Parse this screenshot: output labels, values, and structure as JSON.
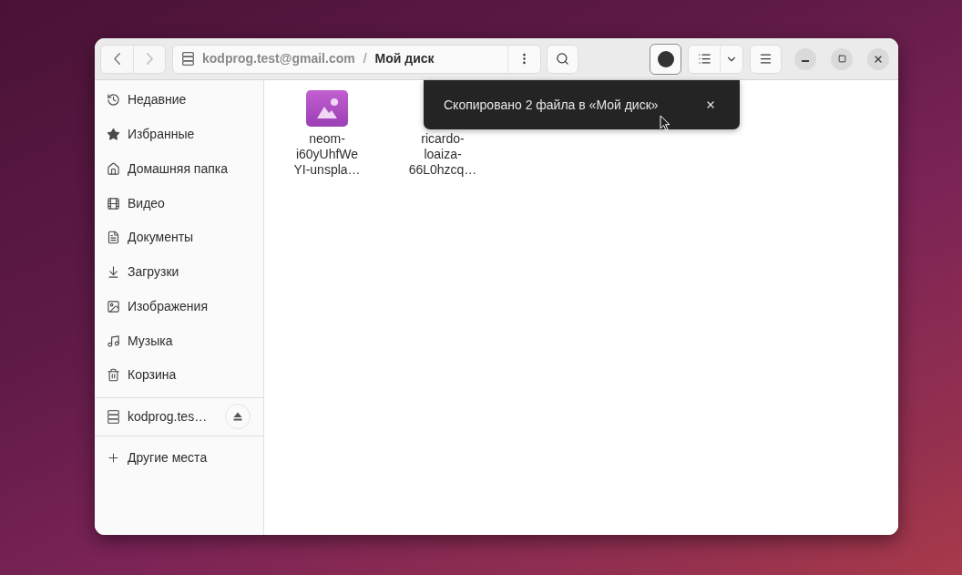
{
  "window": {
    "nav": [
      {
        "kind": "back",
        "disabled": false
      },
      {
        "kind": "forward",
        "disabled": true
      }
    ],
    "path": {
      "location": "kodprog.test@gmail.com",
      "separator": "/",
      "current": "Мой диск"
    }
  },
  "sidebar": {
    "places": [
      {
        "kind": "recent",
        "label": "Недавние"
      },
      {
        "kind": "starred",
        "label": "Избранные"
      },
      {
        "kind": "home",
        "label": "Домашняя папка"
      },
      {
        "kind": "video",
        "label": "Видео"
      },
      {
        "kind": "documents",
        "label": "Документы"
      },
      {
        "kind": "downloads",
        "label": "Загрузки"
      },
      {
        "kind": "pictures",
        "label": "Изображения"
      },
      {
        "kind": "music",
        "label": "Музыка"
      },
      {
        "kind": "trash",
        "label": "Корзина"
      }
    ],
    "drives": [
      {
        "label": "kodprog.tes…"
      }
    ],
    "other_locations": {
      "label": "Другие места"
    }
  },
  "files": [
    {
      "kind": "image",
      "name_lines": [
        "neom-",
        "i60yUhfWe",
        "YI-unspla…"
      ]
    },
    {
      "kind": "covered",
      "name_lines": [
        "ricardo-",
        "loaiza-",
        "66L0hzcq…"
      ]
    }
  ],
  "toast": {
    "message": "Скопировано 2 файла в «Мой диск»"
  }
}
